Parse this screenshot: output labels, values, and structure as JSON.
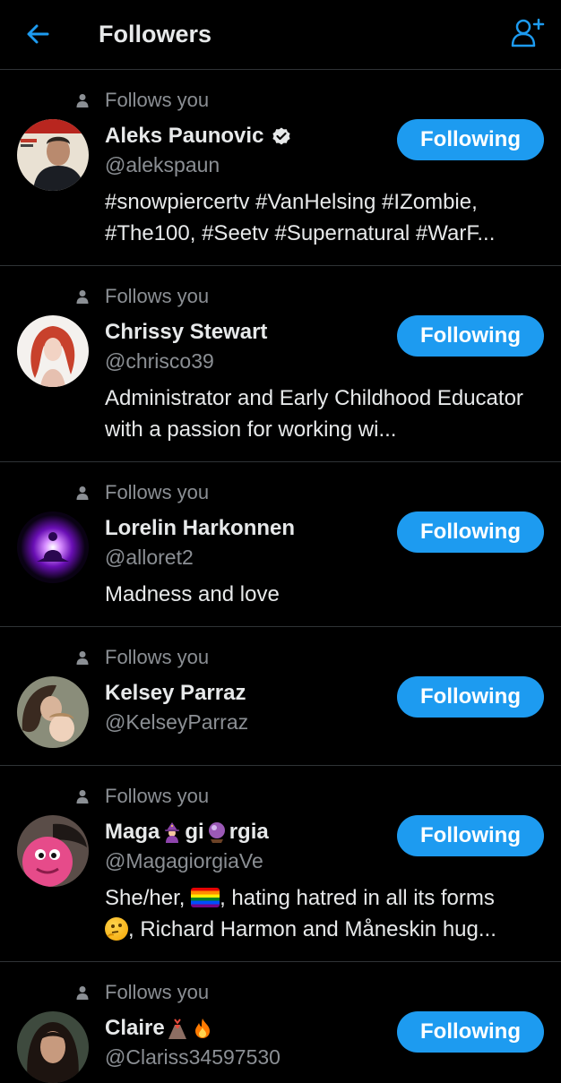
{
  "header": {
    "title": "Followers",
    "back_icon": "arrow-left-icon",
    "add_icon": "add-user-icon",
    "accent": "#1d9bf0"
  },
  "followers": [
    {
      "follows_label": "Follows you",
      "name": "Aleks Paunovic",
      "verified": true,
      "handle": "@alekspaun",
      "bio": "#snowpiercertv #VanHelsing #IZombie, #The100, #Seetv #Supernatural #WarF...",
      "button": "Following"
    },
    {
      "follows_label": "Follows you",
      "name": "Chrissy Stewart",
      "handle": "@chrisco39",
      "bio": "Administrator and Early Childhood Educator with a passion for working wi...",
      "button": "Following"
    },
    {
      "follows_label": "Follows you",
      "name": "Lorelin Harkonnen",
      "handle": "@alloret2",
      "bio": "Madness and love",
      "button": "Following"
    },
    {
      "follows_label": "Follows you",
      "name": "Kelsey Parraz",
      "handle": "@KelseyParraz",
      "bio": "",
      "button": "Following"
    },
    {
      "follows_label": "Follows you",
      "name_parts": [
        "Maga",
        "gi",
        "rgia"
      ],
      "handle": "@MagagiorgiaVe",
      "bio_line1_a": "She/her, ",
      "bio_line1_b": ", hating hatred in all its forms",
      "bio_line2": ", Richard Harmon and Måneskin hug...",
      "button": "Following"
    },
    {
      "follows_label": "Follows you",
      "name": "Claire",
      "handle": "@Clariss34597530",
      "button": "Following"
    }
  ]
}
